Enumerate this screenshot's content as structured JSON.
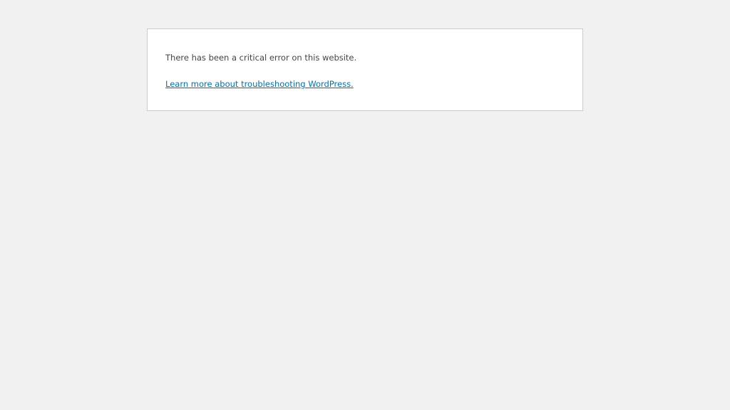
{
  "error": {
    "message": "There has been a critical error on this website.",
    "link_text": "Learn more about troubleshooting WordPress."
  },
  "colors": {
    "background": "#f1f1f1",
    "panel": "#ffffff",
    "border": "#cccccc",
    "text": "#444444",
    "link": "#0073aa"
  }
}
